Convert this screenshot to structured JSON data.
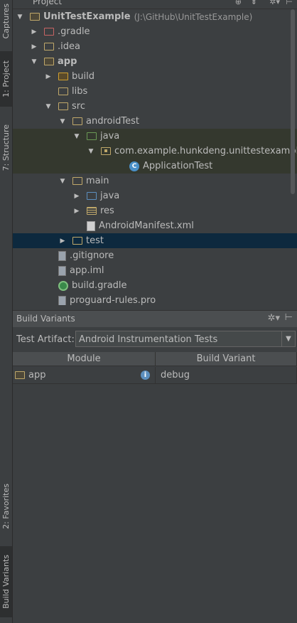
{
  "tool_tabs": {
    "captures": "Captures",
    "project": "1: Project",
    "structure": "7: Structure",
    "favorites": "2: Favorites",
    "build_variants": "Build Variants"
  },
  "project_panel": {
    "title": "Project"
  },
  "tree": [
    {
      "label": "UnitTestExample",
      "path": "(J:\\GitHub\\UnitTestExample)",
      "arrow": "▼",
      "bold": true
    },
    {
      "label": ".gradle",
      "arrow": "▶"
    },
    {
      "label": ".idea",
      "arrow": "▶"
    },
    {
      "label": "app",
      "arrow": "▼",
      "bold": true
    },
    {
      "label": "build",
      "arrow": "▶"
    },
    {
      "label": "libs",
      "arrow": ""
    },
    {
      "label": "src",
      "arrow": "▼"
    },
    {
      "label": "androidTest",
      "arrow": "▼"
    },
    {
      "label": "java",
      "arrow": "▼"
    },
    {
      "label": "com.example.hunkdeng.unittestexample",
      "arrow": "▼"
    },
    {
      "label": "ApplicationTest",
      "arrow": "",
      "italic": false
    },
    {
      "label": "main",
      "arrow": "▼"
    },
    {
      "label": "java",
      "arrow": "▶"
    },
    {
      "label": "res",
      "arrow": "▶"
    },
    {
      "label": "AndroidManifest.xml",
      "arrow": ""
    },
    {
      "label": "test",
      "arrow": "▶"
    },
    {
      "label": ".gitignore",
      "arrow": ""
    },
    {
      "label": "app.iml",
      "arrow": ""
    },
    {
      "label": "build.gradle",
      "arrow": ""
    },
    {
      "label": "proguard-rules.pro",
      "arrow": ""
    }
  ],
  "build_variants": {
    "title": "Build Variants",
    "artifact_label": "Test Artifact:",
    "artifact_value": "Android Instrumentation Tests",
    "columns": [
      "Module",
      "Build Variant"
    ],
    "rows": [
      {
        "module": "app",
        "variant": "debug"
      }
    ]
  },
  "colors": {
    "folder": "#c0a86a",
    "selected_row": "#0d293e",
    "test_folder_green": "#6a8759",
    "class_icon": "#4a90c8"
  }
}
